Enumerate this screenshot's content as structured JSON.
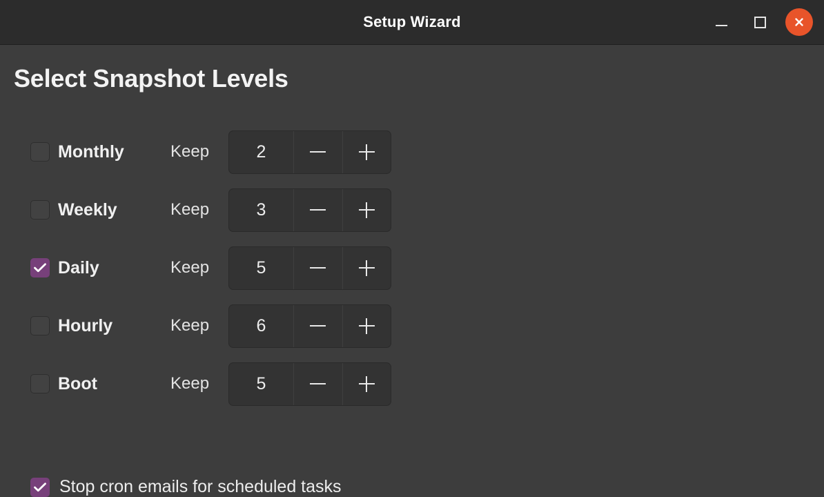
{
  "window": {
    "title": "Setup Wizard",
    "controls": [
      {
        "name": "minimize-button",
        "icon": "minimize-icon",
        "label": "–"
      },
      {
        "name": "maximize-button",
        "icon": "maximize-icon",
        "label": "□"
      },
      {
        "name": "close-button",
        "icon": "close-icon",
        "label": "✕"
      }
    ]
  },
  "page": {
    "title": "Select Snapshot Levels"
  },
  "levels": [
    {
      "label": "Monthly",
      "checked": false,
      "keep_label": "Keep",
      "value": "2",
      "minus": "—",
      "plus": "+"
    },
    {
      "label": "Weekly",
      "checked": false,
      "keep_label": "Keep",
      "value": "3",
      "minus": "—",
      "plus": "+"
    },
    {
      "label": "Daily",
      "checked": true,
      "keep_label": "Keep",
      "value": "5",
      "minus": "—",
      "plus": "+"
    },
    {
      "label": "Hourly",
      "checked": false,
      "keep_label": "Keep",
      "value": "6",
      "minus": "—",
      "plus": "+"
    },
    {
      "label": "Boot",
      "checked": false,
      "keep_label": "Keep",
      "value": "5",
      "minus": "—",
      "plus": "+"
    }
  ],
  "footer_option": {
    "label": "Stop cron emails for scheduled tasks",
    "checked": true
  },
  "colors": {
    "titlebar_bg": "#2c2c2c",
    "body_bg": "#3d3d3d",
    "accent_checked": "#77407a",
    "close_button": "#e8542a",
    "text_primary": "#f0f0f0",
    "spinner_bg": "#333333",
    "checkbox_off_bg": "#424242"
  }
}
